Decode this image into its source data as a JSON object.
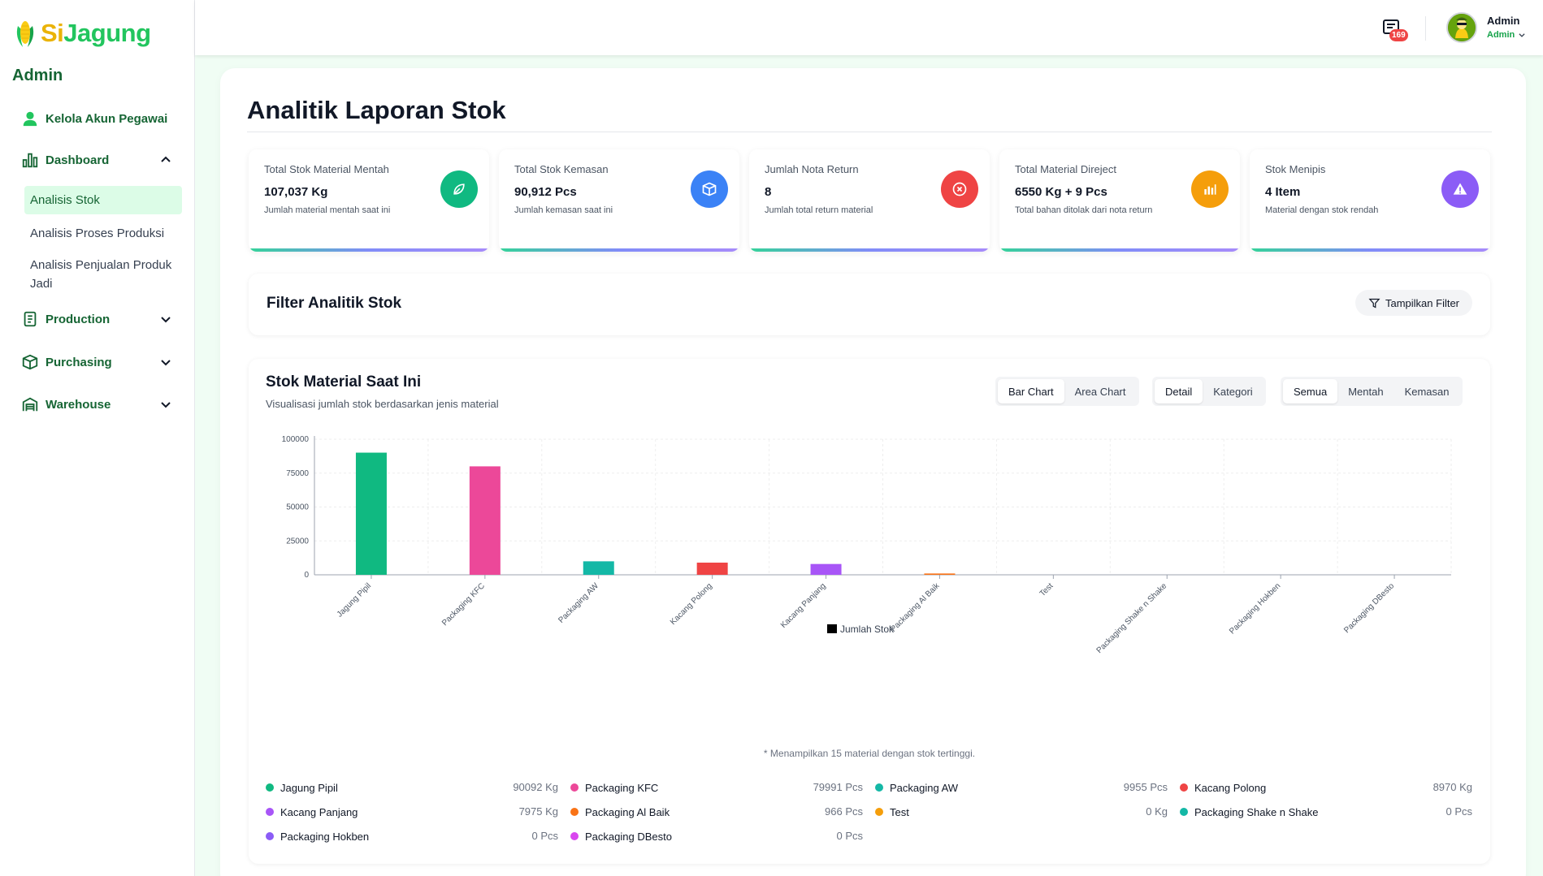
{
  "sidebar": {
    "logo_si": "Si",
    "logo_jagung": "Jagung",
    "role": "Admin",
    "nav": [
      {
        "label": "Kelola Akun Pegawai"
      },
      {
        "label": "Dashboard"
      },
      {
        "label": "Production"
      },
      {
        "label": "Purchasing"
      },
      {
        "label": "Warehouse"
      }
    ],
    "dashboard_sub": [
      {
        "label": "Analisis Stok",
        "active": true
      },
      {
        "label": "Analisis Proses Produksi"
      },
      {
        "label": "Analisis Penjualan Produk Jadi"
      }
    ]
  },
  "header": {
    "notif_count": "169",
    "user_name": "Admin",
    "user_role": "Admin"
  },
  "page": {
    "title": "Analitik Laporan Stok"
  },
  "cards": [
    {
      "label": "Total Stok Material Mentah",
      "value": "107,037 Kg",
      "desc": "Jumlah material mentah saat ini",
      "icon": "leaf-icon",
      "color": "#10b981"
    },
    {
      "label": "Total Stok Kemasan",
      "value": "90,912 Pcs",
      "desc": "Jumlah kemasan saat ini",
      "icon": "box-icon",
      "color": "#3b82f6"
    },
    {
      "label": "Jumlah Nota Return",
      "value": "8",
      "desc": "Jumlah total return material",
      "icon": "x-circle-icon",
      "color": "#ef4444"
    },
    {
      "label": "Total Material Direject",
      "value": "6550 Kg + 9 Pcs",
      "desc": "Total bahan ditolak dari nota return",
      "icon": "bar-chart-icon",
      "color": "#f59e0b"
    },
    {
      "label": "Stok Menipis",
      "value": "4 Item",
      "desc": "Material dengan stok rendah",
      "icon": "warning-icon",
      "color": "#8b5cf6"
    }
  ],
  "filter": {
    "title": "Filter Analitik Stok",
    "button": "Tampilkan Filter"
  },
  "chart_section": {
    "title": "Stok Material Saat Ini",
    "subtitle": "Visualisasi jumlah stok berdasarkan jenis material",
    "chart_type_options": [
      "Bar Chart",
      "Area Chart"
    ],
    "chart_type_selected": "Bar Chart",
    "view_options": [
      "Detail",
      "Kategori"
    ],
    "view_selected": "Detail",
    "material_options": [
      "Semua",
      "Mentah",
      "Kemasan"
    ],
    "material_selected": "Semua",
    "note": "* Menampilkan 15 material dengan stok tertinggi.",
    "legend_label": "Jumlah Stok"
  },
  "chart_data": {
    "type": "bar",
    "categories": [
      "Jagung Pipil",
      "Packaging KFC",
      "Packaging AW",
      "Kacang Polong",
      "Kacang Panjang",
      "Packaging Al Baik",
      "Test",
      "Packaging Shake n Shake",
      "Packaging Hokben",
      "Packaging DBesto"
    ],
    "series": [
      {
        "name": "Jumlah Stok",
        "values": [
          90092,
          79991,
          9955,
          8970,
          7975,
          966,
          0,
          0,
          0,
          0
        ]
      }
    ],
    "colors": [
      "#10b981",
      "#ec4899",
      "#14b8a6",
      "#ef4444",
      "#a855f7",
      "#f97316",
      "#f59e0b",
      "#14b8a6",
      "#8b5cf6",
      "#d946ef"
    ],
    "yticks": [
      0,
      25000,
      50000,
      75000,
      100000
    ],
    "ylim": [
      0,
      100000
    ],
    "grid": true,
    "legend": "bottom-center"
  },
  "material_list": [
    {
      "name": "Jagung Pipil",
      "value": "90092 Kg",
      "color": "#10b981"
    },
    {
      "name": "Packaging KFC",
      "value": "79991 Pcs",
      "color": "#ec4899"
    },
    {
      "name": "Packaging AW",
      "value": "9955 Pcs",
      "color": "#14b8a6"
    },
    {
      "name": "Kacang Polong",
      "value": "8970 Kg",
      "color": "#ef4444"
    },
    {
      "name": "Kacang Panjang",
      "value": "7975 Kg",
      "color": "#a855f7"
    },
    {
      "name": "Packaging Al Baik",
      "value": "966 Pcs",
      "color": "#f97316"
    },
    {
      "name": "Test",
      "value": "0 Kg",
      "color": "#f59e0b"
    },
    {
      "name": "Packaging Shake n Shake",
      "value": "0 Pcs",
      "color": "#14b8a6"
    },
    {
      "name": "Packaging Hokben",
      "value": "0 Pcs",
      "color": "#8b5cf6"
    },
    {
      "name": "Packaging DBesto",
      "value": "0 Pcs",
      "color": "#d946ef"
    }
  ]
}
